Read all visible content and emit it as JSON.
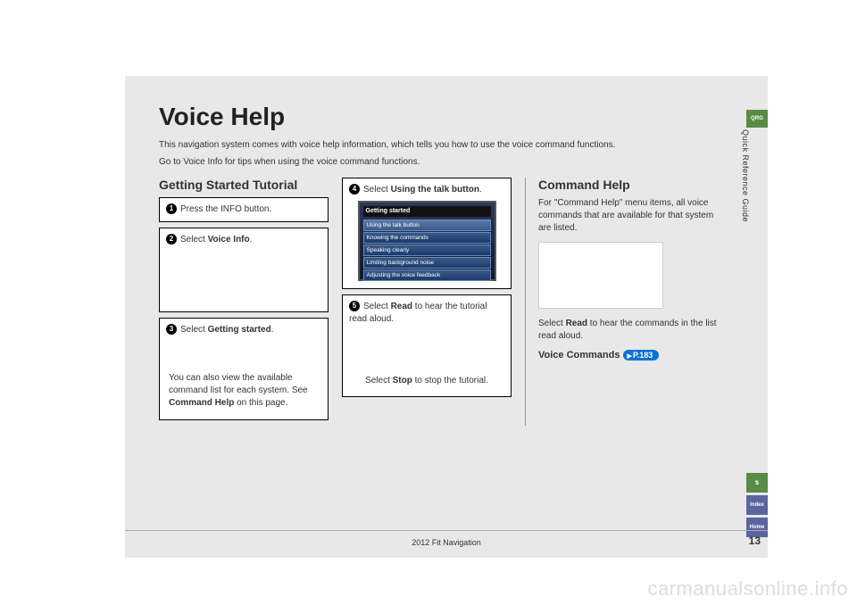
{
  "title": "Voice Help",
  "intro1": "This navigation system comes with voice help information, which tells you how to use the voice command functions.",
  "intro2": "Go to Voice Info for tips when using the voice command functions.",
  "tutorial_heading": "Getting Started Tutorial",
  "step1_num": "1",
  "step1_text": "Press the INFO button.",
  "step2_num": "2",
  "step2_pre": "Select ",
  "step2_bold": "Voice Info",
  "step2_post": ".",
  "step3_num": "3",
  "step3_pre": "Select ",
  "step3_bold": "Getting started",
  "step3_post": ".",
  "step3_note_a": "You can also view the available command list for each system. See ",
  "step3_note_bold": "Command Help",
  "step3_note_b": " on this page.",
  "step4_num": "4",
  "step4_pre": "Select ",
  "step4_bold": "Using the talk button",
  "step4_post": ".",
  "ss_header": "Getting started",
  "ss_item1": "Using the talk button",
  "ss_item2": "Knowing the commands",
  "ss_item3": "Speaking clearly",
  "ss_item4": "Limiting background noise",
  "ss_item5": "Adjusting the voice feedback",
  "step5_num": "5",
  "step5_pre1": "Select ",
  "step5_bold1": "Read",
  "step5_post1": " to hear the tutorial read aloud.",
  "step5_stop_pre": "Select ",
  "step5_stop_bold": "Stop",
  "step5_stop_post": " to stop the tutorial.",
  "cmd_heading": "Command Help",
  "cmd_body": "For \"Command Help\" menu items, all voice commands that are available for that system are listed.",
  "cmd_read_pre": "Select ",
  "cmd_read_bold": "Read",
  "cmd_read_post": " to hear the commands in the list read aloud.",
  "cmd_link_label": "Voice Commands ",
  "cmd_link_pill": "P.183",
  "side_label": "Quick Reference Guide",
  "tab_qrg": "QRG",
  "tab_voice": "⇅",
  "tab_index": "Index",
  "tab_home": "Home",
  "footer_center": "2012 Fit Navigation",
  "page_num": "13",
  "watermark": "carmanualsonline.info"
}
